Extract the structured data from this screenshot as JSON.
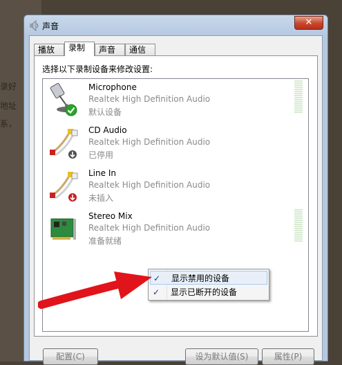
{
  "window": {
    "title": "声音",
    "close_glyph": "✕",
    "tabs": [
      {
        "label": "播放",
        "active": false
      },
      {
        "label": "录制",
        "active": true
      },
      {
        "label": "声音",
        "active": false
      },
      {
        "label": "通信",
        "active": false
      }
    ],
    "instruction": "选择以下录制设备来修改设置:",
    "devices": [
      {
        "name": "Microphone",
        "driver": "Realtek High Definition Audio",
        "status": "默认设备",
        "icon": "microphone-icon",
        "badge": "default-check-icon"
      },
      {
        "name": "CD Audio",
        "driver": "Realtek High Definition Audio",
        "status": "已停用",
        "icon": "audio-cable-icon",
        "badge": "disabled-arrow-icon"
      },
      {
        "name": "Line In",
        "driver": "Realtek High Definition Audio",
        "status": "未插入",
        "icon": "audio-cable-icon",
        "badge": "unplugged-arrow-icon"
      },
      {
        "name": "Stereo Mix",
        "driver": "Realtek High Definition Audio",
        "status": "准备就绪",
        "icon": "sound-card-icon",
        "badge": ""
      }
    ],
    "context_menu": [
      {
        "label": "显示禁用的设备",
        "checked": true
      },
      {
        "label": "显示已断开的设备",
        "checked": true
      }
    ],
    "check_glyph": "✓",
    "buttons": {
      "configure": "配置(C)",
      "set_default": "设为默认值(S)",
      "properties": "属性(P)"
    }
  },
  "background_text": [
    "录好",
    "地址",
    "系，"
  ],
  "colors": {
    "accent_arrow": "#e0141a",
    "default_check": "#2aa52a",
    "meter_green": "#8ccf78"
  }
}
